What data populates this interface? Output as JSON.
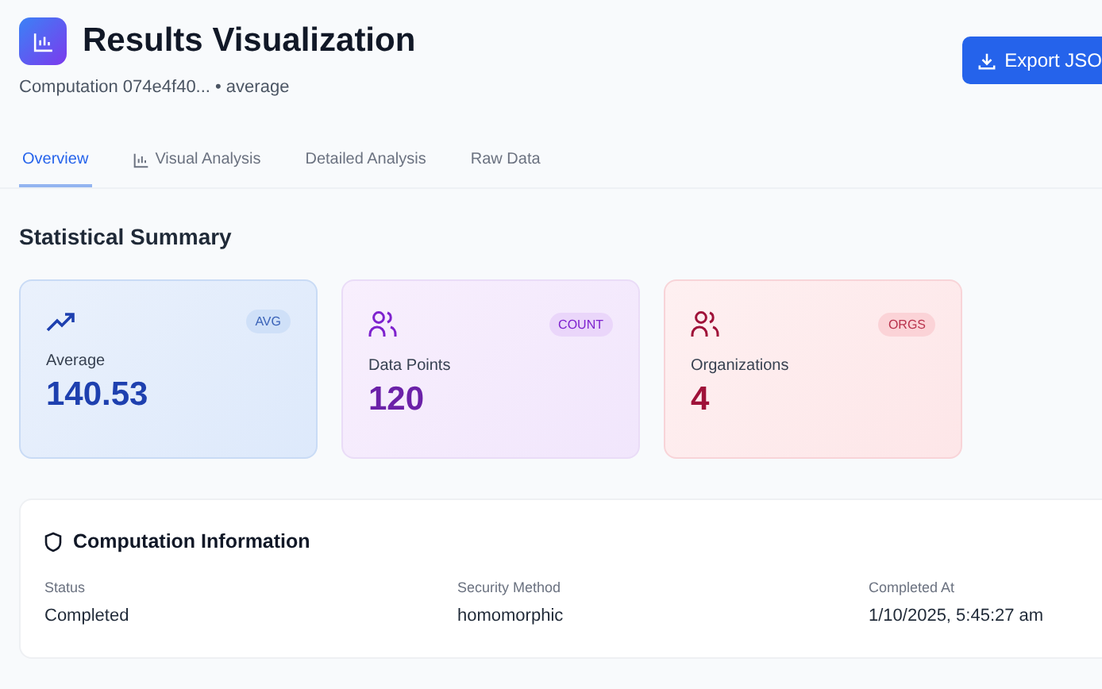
{
  "header": {
    "title": "Results Visualization",
    "subtitle": "Computation 074e4f40... • average",
    "export_button": "Export JSO"
  },
  "tabs": [
    {
      "label": "Overview",
      "selected": true,
      "icon": false
    },
    {
      "label": "Visual Analysis",
      "selected": false,
      "icon": true
    },
    {
      "label": "Detailed Analysis",
      "selected": false,
      "icon": false
    },
    {
      "label": "Raw Data",
      "selected": false,
      "icon": false
    }
  ],
  "summary": {
    "title": "Statistical Summary",
    "cards": [
      {
        "kind": "trend",
        "color": "#1e40af",
        "badge": "AVG",
        "label": "Average",
        "value": "140.53"
      },
      {
        "kind": "people",
        "color": "#7e22ce",
        "badge": "COUNT",
        "label": "Data Points",
        "value": "120"
      },
      {
        "kind": "people",
        "color": "#9f1239",
        "badge": "ORGS",
        "label": "Organizations",
        "value": "4"
      }
    ]
  },
  "info": {
    "title": "Computation Information",
    "fields": [
      {
        "label": "Status",
        "value": "Completed"
      },
      {
        "label": "Security Method",
        "value": "homomorphic"
      },
      {
        "label": "Completed At",
        "value": "1/10/2025, 5:45:27 am"
      }
    ]
  }
}
